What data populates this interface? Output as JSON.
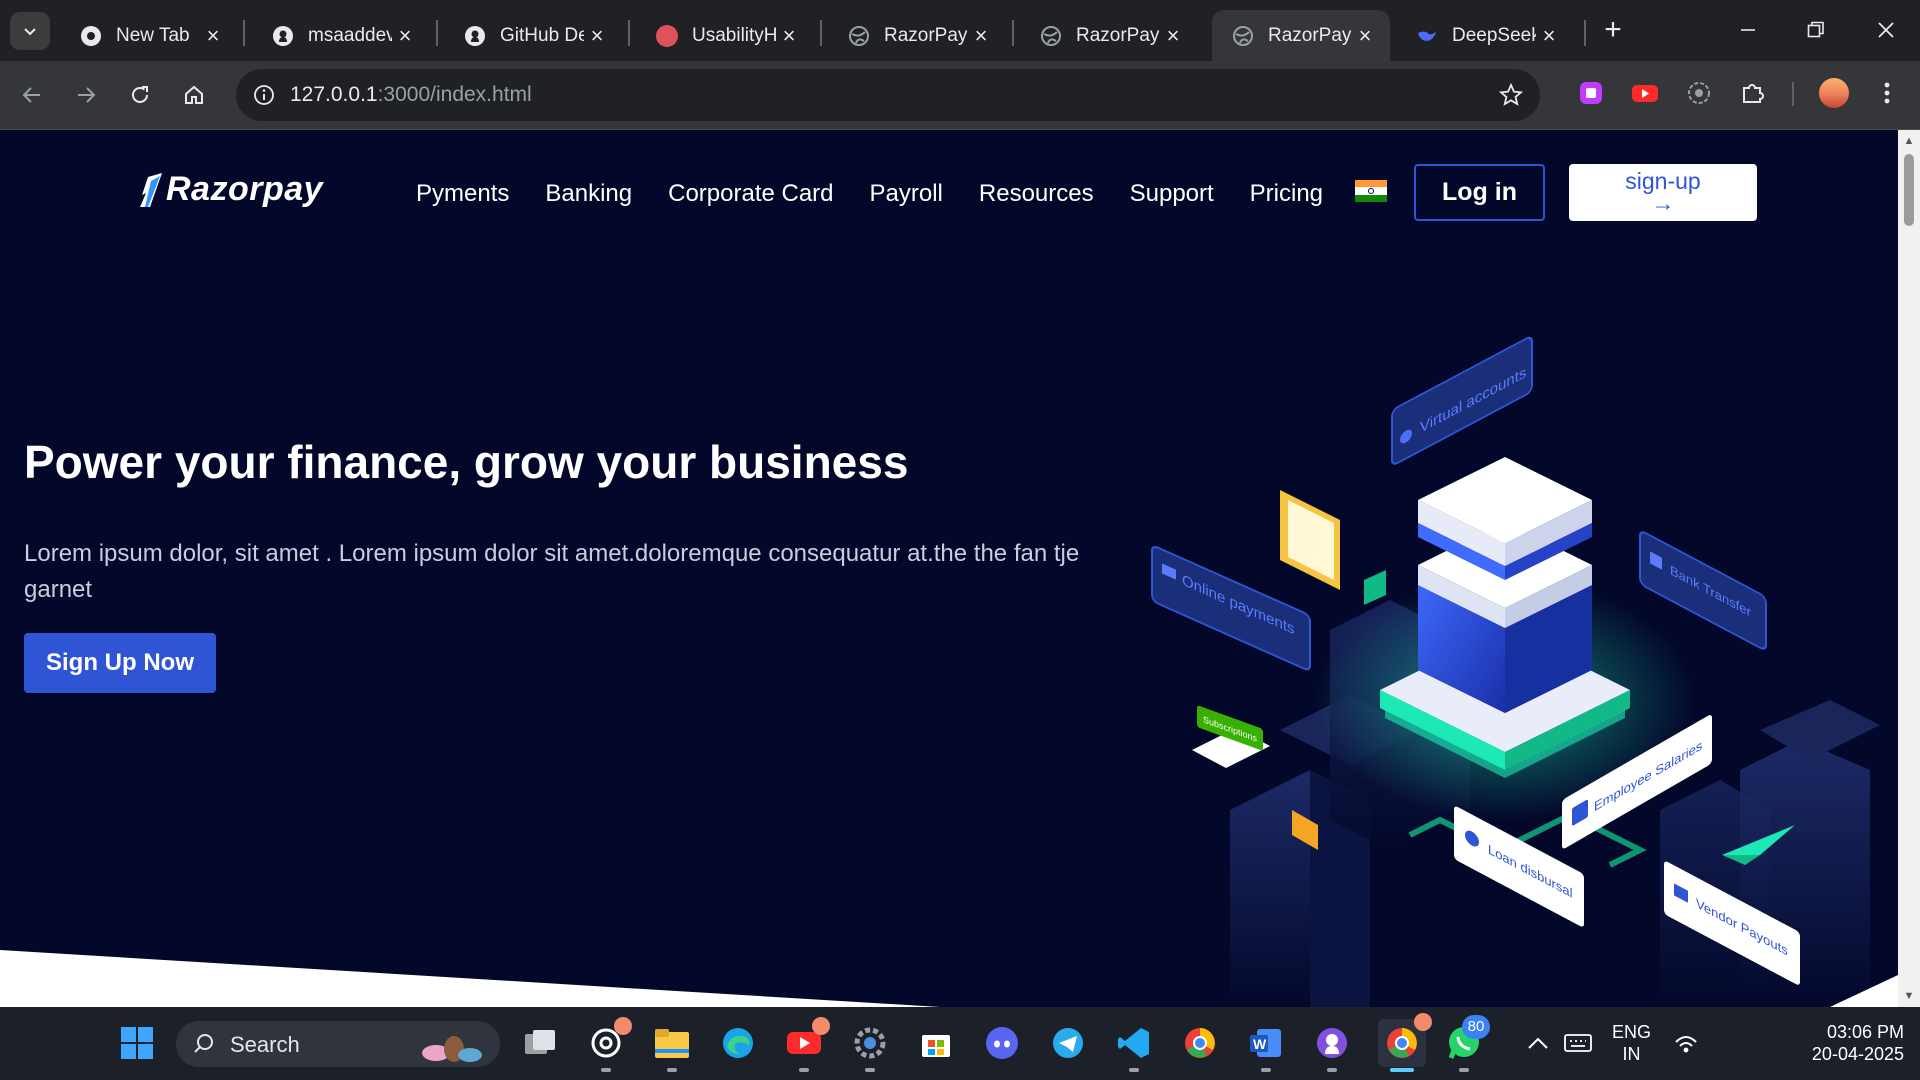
{
  "browser": {
    "tabs": [
      {
        "title": "New Tab",
        "icon": "chrome-icon",
        "active": false
      },
      {
        "title": "msaaddev/",
        "icon": "github-icon",
        "active": false
      },
      {
        "title": "GitHub De",
        "icon": "github-icon",
        "active": false
      },
      {
        "title": "UsabilityH",
        "icon": "usabilityhub-icon",
        "active": false
      },
      {
        "title": "RazorPay",
        "icon": "globe-icon",
        "active": false
      },
      {
        "title": "RazorPay",
        "icon": "globe-icon",
        "active": false
      },
      {
        "title": "RazorPay",
        "icon": "globe-icon",
        "active": true
      },
      {
        "title": "DeepSeek",
        "icon": "deepseek-icon",
        "active": false
      }
    ],
    "url_host": "127.0.0.1",
    "url_rest": ":3000/index.html"
  },
  "page": {
    "logo": "Razorpay",
    "nav": [
      "Pyments",
      "Banking",
      "Corporate Card",
      "Payroll",
      "Resources",
      "Support",
      "Pricing"
    ],
    "login_label": "Log in",
    "signup_label": "sign-up",
    "signup_arrow": "→",
    "hero_title": "Power your finance, grow your business",
    "hero_text": "Lorem ipsum dolor, sit amet . Lorem ipsum dolor sit amet.doloremque consequatur at.the the fan tje garnet",
    "cta_label": "Sign Up Now",
    "illustration_labels": {
      "virtual_accounts": "Virtual accounts",
      "online_payments": "Online payments",
      "bank_transfer": "Bank Transfer",
      "subscriptions": "Subscriptions",
      "employee_salaries": "Employee Salaries",
      "loan_disbursal": "Loan disbursal",
      "vendor_payouts": "Vendor Payouts"
    },
    "colors": {
      "background": "#03082a",
      "accent": "#2f55d4",
      "glow": "#1de9b6"
    }
  },
  "taskbar": {
    "search_label": "Search",
    "whatsapp_badge": "80",
    "language": "ENG",
    "region": "IN",
    "time": "03:06 PM",
    "date": "20-04-2025"
  }
}
